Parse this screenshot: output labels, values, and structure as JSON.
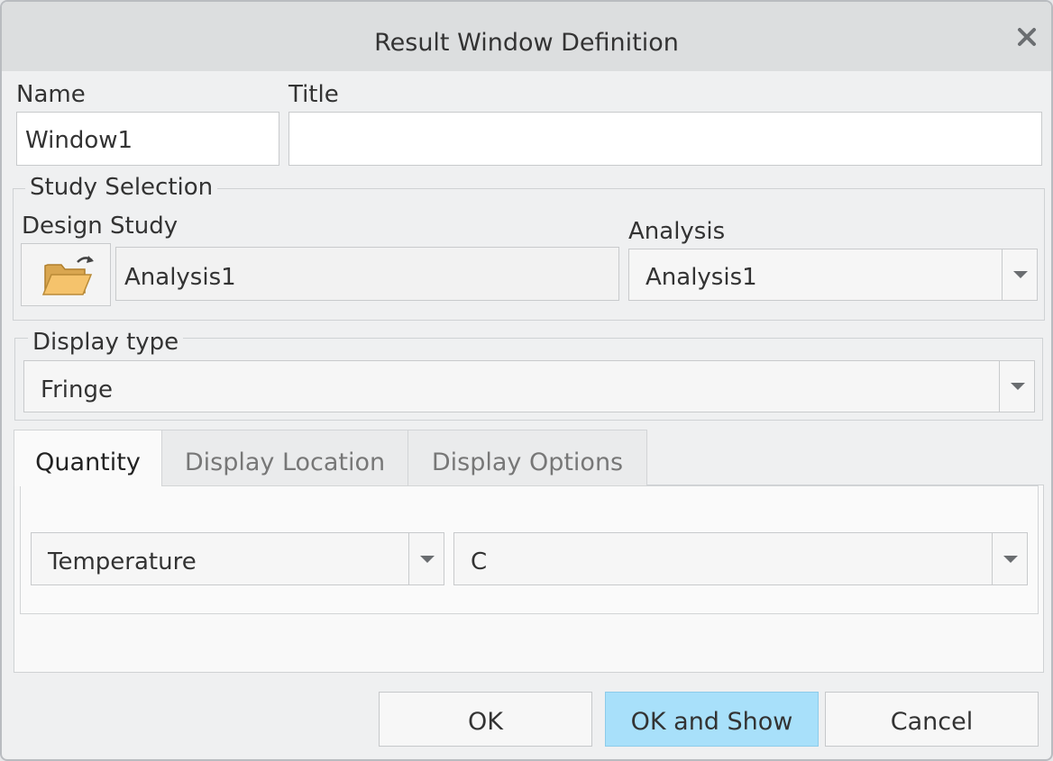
{
  "dialog": {
    "title": "Result Window Definition"
  },
  "icons": {
    "close": "close-icon",
    "open": "open-folder-icon"
  },
  "fields": {
    "name_label": "Name",
    "name_value": "Window1",
    "title_label": "Title",
    "title_value": ""
  },
  "study_selection": {
    "legend": "Study Selection",
    "design_study_label": "Design Study",
    "design_study_value": "Analysis1",
    "analysis_label": "Analysis",
    "analysis_value": "Analysis1"
  },
  "display_type": {
    "legend": "Display type",
    "value": "Fringe"
  },
  "tabs": [
    {
      "label": "Quantity",
      "active": true
    },
    {
      "label": "Display Location",
      "active": false
    },
    {
      "label": "Display Options",
      "active": false
    }
  ],
  "quantity": {
    "quantity_value": "Temperature",
    "units_value": "C"
  },
  "buttons": {
    "ok": "OK",
    "ok_and_show": "OK and Show",
    "cancel": "Cancel"
  },
  "colors": {
    "default_button": "#a8e0fa",
    "folder_icon": "#f0b85c"
  }
}
